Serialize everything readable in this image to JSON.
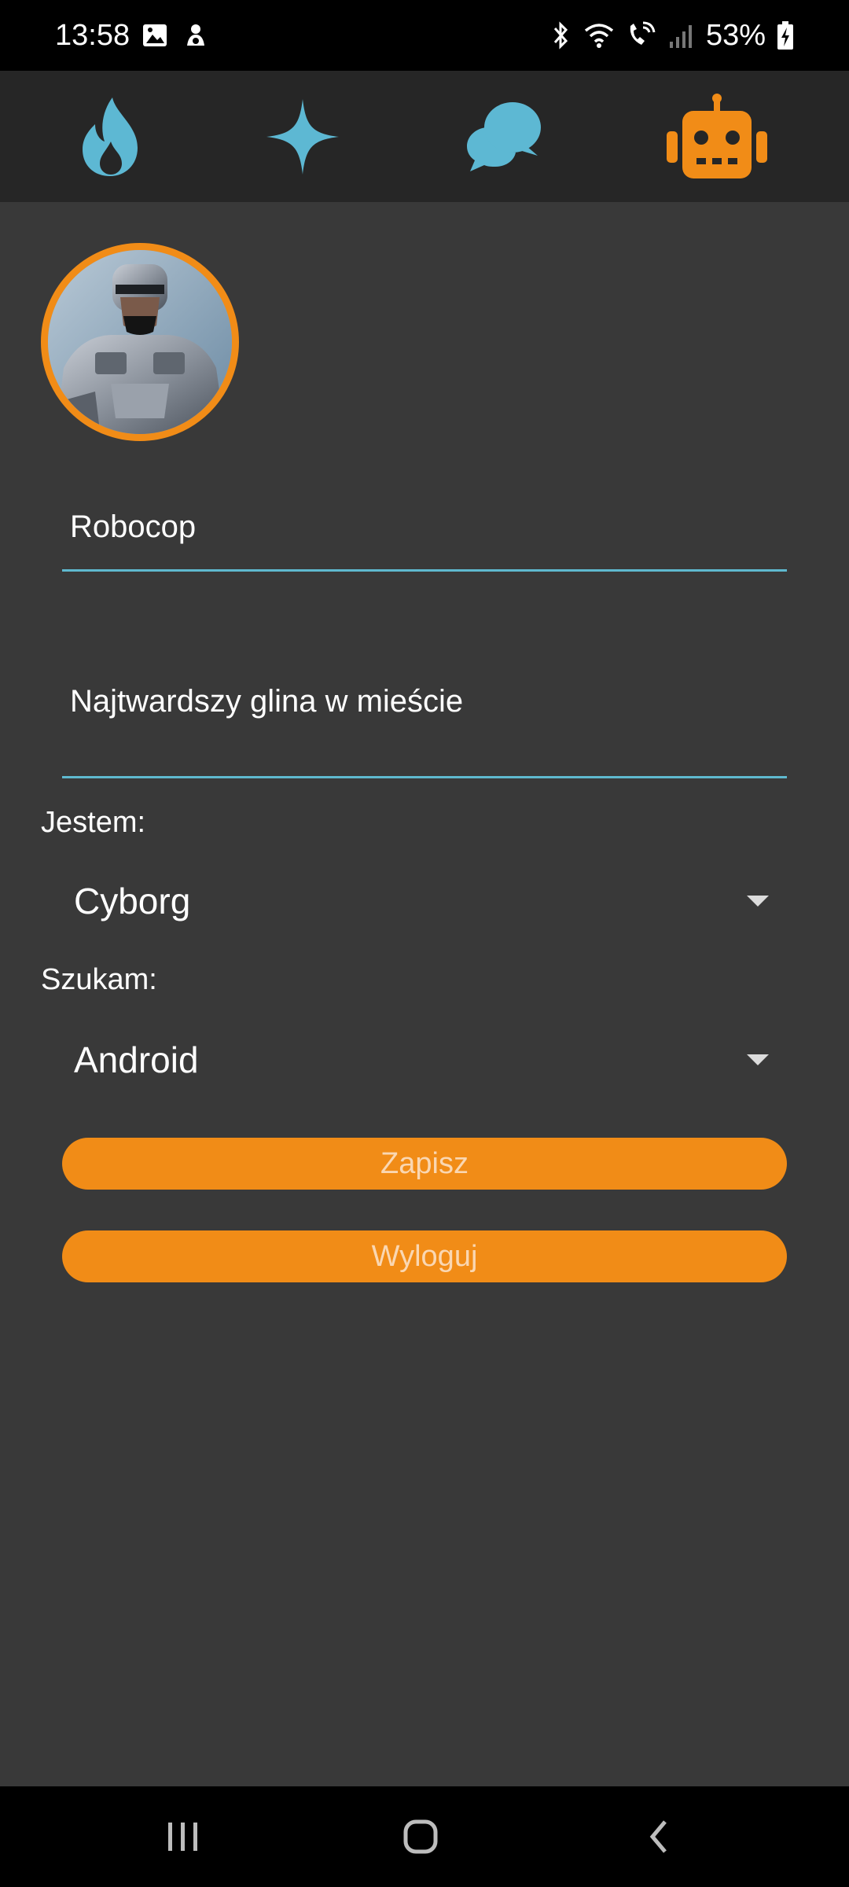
{
  "status_bar": {
    "time": "13:58",
    "battery": "53%"
  },
  "nav": {
    "items": [
      {
        "icon": "flame-icon",
        "color": "#5db8d3"
      },
      {
        "icon": "sparkle-icon",
        "color": "#5db8d3"
      },
      {
        "icon": "chat-bubbles-icon",
        "color": "#5db8d3"
      },
      {
        "icon": "robot-icon",
        "color": "#f18c17",
        "active": true
      }
    ]
  },
  "profile": {
    "name": "Robocop",
    "description": "Najtwardszy glina w mieście",
    "iam_label": "Jestem:",
    "iam_value": "Cyborg",
    "seeking_label": "Szukam:",
    "seeking_value": "Android",
    "save_label": "Zapisz",
    "logout_label": "Wyloguj"
  },
  "colors": {
    "accent": "#f18c17",
    "secondary": "#5db8d3",
    "background": "#393939",
    "topbar": "#262626"
  }
}
